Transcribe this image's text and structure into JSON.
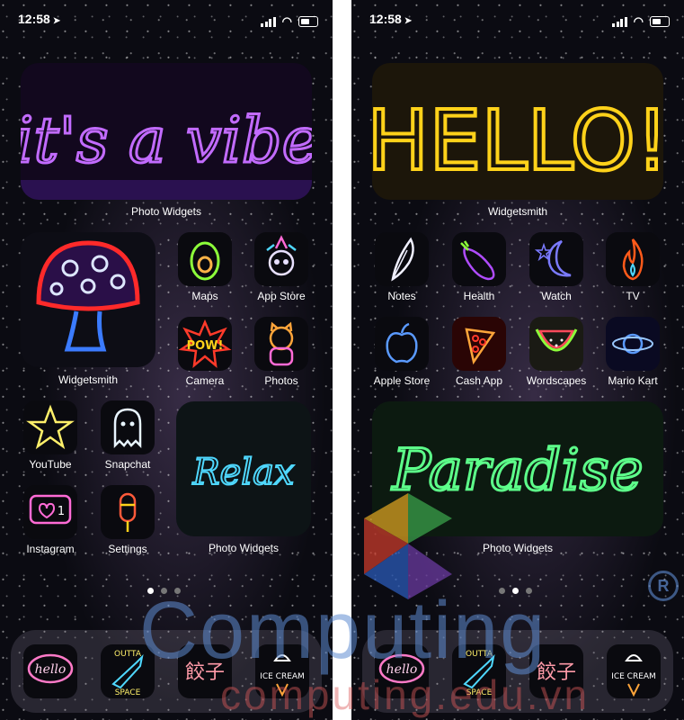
{
  "status": {
    "time": "12:58"
  },
  "left": {
    "widget_top_text": "it's a vibe",
    "widget_top_label": "Photo Widgets",
    "mushroom_label": "Widgetsmith",
    "apps": [
      {
        "label": "Maps",
        "icon": "avocado-icon"
      },
      {
        "label": "App Store",
        "icon": "skull-unicorn-icon"
      },
      {
        "label": "Camera",
        "icon": "pow-icon"
      },
      {
        "label": "Photos",
        "icon": "lucky-cat-icon"
      },
      {
        "label": "YouTube",
        "icon": "star-icon"
      },
      {
        "label": "Snapchat",
        "icon": "ghost-icon"
      },
      {
        "label": "Instagram",
        "icon": "heart-like-icon"
      },
      {
        "label": "Settings",
        "icon": "popsicle-icon"
      }
    ],
    "instagram_count": "1",
    "widget_relax_text": "Relax",
    "widget_relax_label": "Photo Widgets"
  },
  "right": {
    "widget_top_text": "HELLO!",
    "widget_top_label": "Widgetsmith",
    "apps": [
      {
        "label": "Notes",
        "icon": "feather-icon"
      },
      {
        "label": "Health",
        "icon": "eggplant-icon"
      },
      {
        "label": "Watch",
        "icon": "moon-star-icon"
      },
      {
        "label": "TV",
        "icon": "flame-icon"
      },
      {
        "label": "Apple Store",
        "icon": "apple-icon"
      },
      {
        "label": "Cash App",
        "icon": "pizza-icon"
      },
      {
        "label": "Wordscapes",
        "icon": "watermelon-icon"
      },
      {
        "label": "Mario Kart",
        "icon": "planet-icon"
      }
    ],
    "widget_paradise_text": "Paradise",
    "widget_paradise_label": "Photo Widgets"
  },
  "dock": {
    "hello_text": "hello",
    "space_text_top": "OUTTA",
    "space_text_bottom": "SPACE",
    "gyoza_text": "餃子",
    "icecream_text": "ICE CREAM"
  },
  "watermark": {
    "main": "Computing",
    "sub": "computing.edu.vn",
    "reg": "R"
  },
  "colors": {
    "vibe": "#b04cff",
    "hello": "#ffd21a",
    "relax": "#4fd8ff",
    "paradise": "#5dff8a",
    "mushroom_red": "#ff2a2a",
    "watermark_blue": "#5f8cd2"
  }
}
